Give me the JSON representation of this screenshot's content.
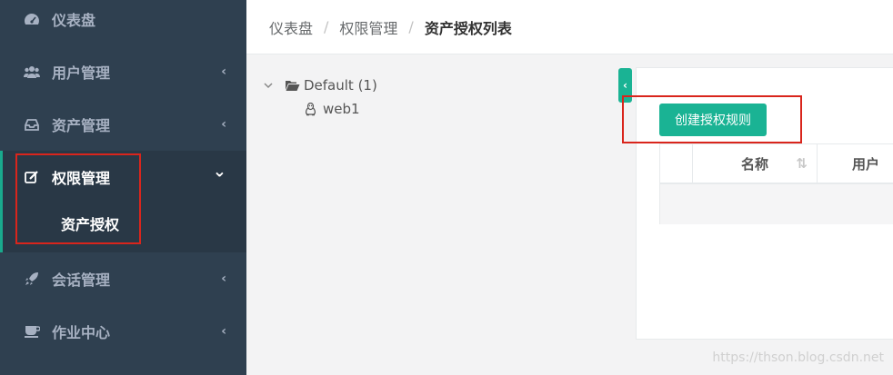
{
  "sidebar": {
    "items": [
      {
        "label": "仪表盘",
        "icon": "dashboard-icon",
        "has_arrow": false
      },
      {
        "label": "用户管理",
        "icon": "users-icon",
        "has_arrow": true
      },
      {
        "label": "资产管理",
        "icon": "inbox-icon",
        "has_arrow": true
      },
      {
        "label": "权限管理",
        "icon": "edit-icon",
        "has_arrow": true,
        "expanded": true
      },
      {
        "label": "会话管理",
        "icon": "rocket-icon",
        "has_arrow": true
      },
      {
        "label": "作业中心",
        "icon": "coffee-icon",
        "has_arrow": true
      }
    ],
    "sub_items": [
      {
        "label": "资产授权",
        "active": true
      }
    ],
    "arrow_collapsed": "‹",
    "arrow_expanded": "⌄"
  },
  "breadcrumb": {
    "items": [
      "仪表盘",
      "权限管理",
      "资产授权列表"
    ],
    "separator": "/"
  },
  "tree": {
    "root": {
      "label": "Default (1)",
      "icon": "folder-open-icon",
      "expanded": true
    },
    "children": [
      {
        "label": "web1",
        "icon": "linux-icon"
      }
    ]
  },
  "panel": {
    "collapse_glyph": "‹",
    "create_button": "创建授权规则",
    "table": {
      "columns": [
        "",
        "名称",
        "用户"
      ]
    }
  },
  "watermark": "https://thson.blog.csdn.net",
  "colors": {
    "sidebar_bg": "#2f4050",
    "accent": "#1ab394",
    "highlight_box": "#d9251c"
  }
}
